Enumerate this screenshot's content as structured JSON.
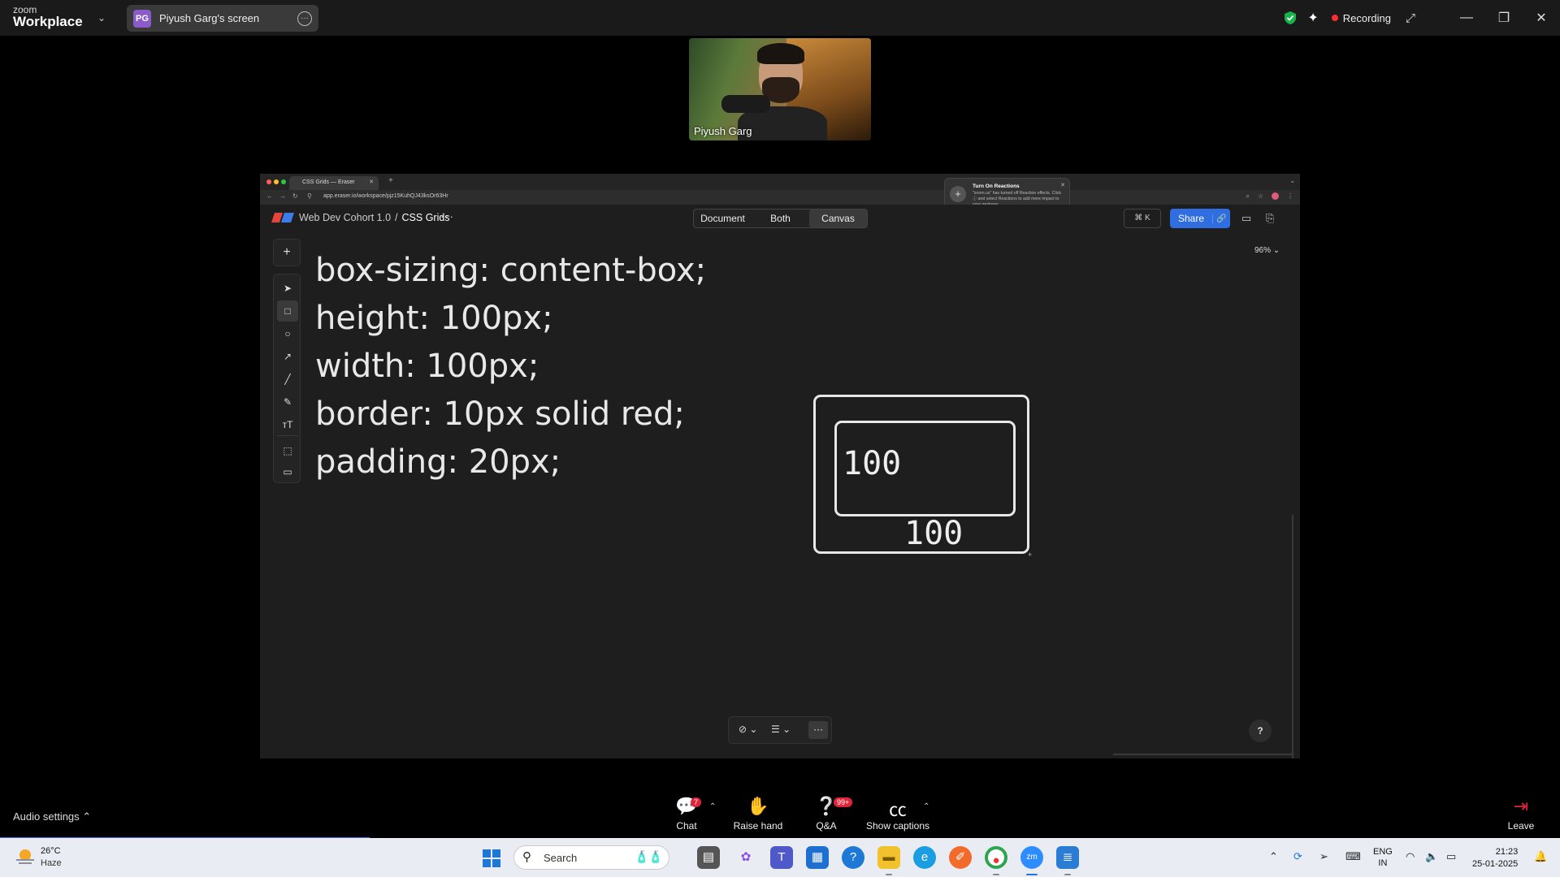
{
  "zoom": {
    "logo_small": "zoom",
    "logo_big": "Workplace",
    "screen_avatar": "PG",
    "screen_label": "Piyush Garg's screen",
    "recording_label": "Recording",
    "participant_name": "Piyush Garg",
    "audio_settings": "Audio settings",
    "controls": {
      "chat": "Chat",
      "chat_badge": "7",
      "raise_hand": "Raise hand",
      "qa": "Q&A",
      "qa_badge": "99+",
      "captions": "Show captions",
      "leave": "Leave"
    },
    "colors": {
      "recording": "#ff2d2d",
      "leave": "#e0243a",
      "share": "#2f6de1"
    }
  },
  "browser": {
    "tab_title": "CSS Grids — Eraser",
    "url": "app.eraser.io/workspace/pjz15KuhQJ43ksOr63Hr",
    "notification": {
      "title": "Turn On Reactions",
      "body": "\"zoom.us\" has turned off Reaction effects. Click ⓘ and select Reactions to add more impact to your gestures."
    }
  },
  "eraser": {
    "breadcrumb_parent": "Web Dev Cohort 1.0",
    "breadcrumb_sep": "/",
    "breadcrumb_current": "CSS Grids",
    "view_modes": [
      "Document",
      "Both",
      "Canvas"
    ],
    "active_view": "Canvas",
    "shortcut": "⌘ K",
    "share_label": "Share",
    "zoom_level": "96%",
    "help": "?",
    "canvas_text": [
      "box-sizing: content-box;",
      "height: 100px;",
      "width: 100px;",
      "border: 10px solid red;",
      "padding: 20px;"
    ],
    "box_labels": [
      "100",
      "100"
    ]
  },
  "taskbar": {
    "temperature": "26°C",
    "weather": "Haze",
    "search_placeholder": "Search",
    "language": "ENG",
    "region": "IN",
    "time": "21:23",
    "date": "25-01-2025"
  }
}
